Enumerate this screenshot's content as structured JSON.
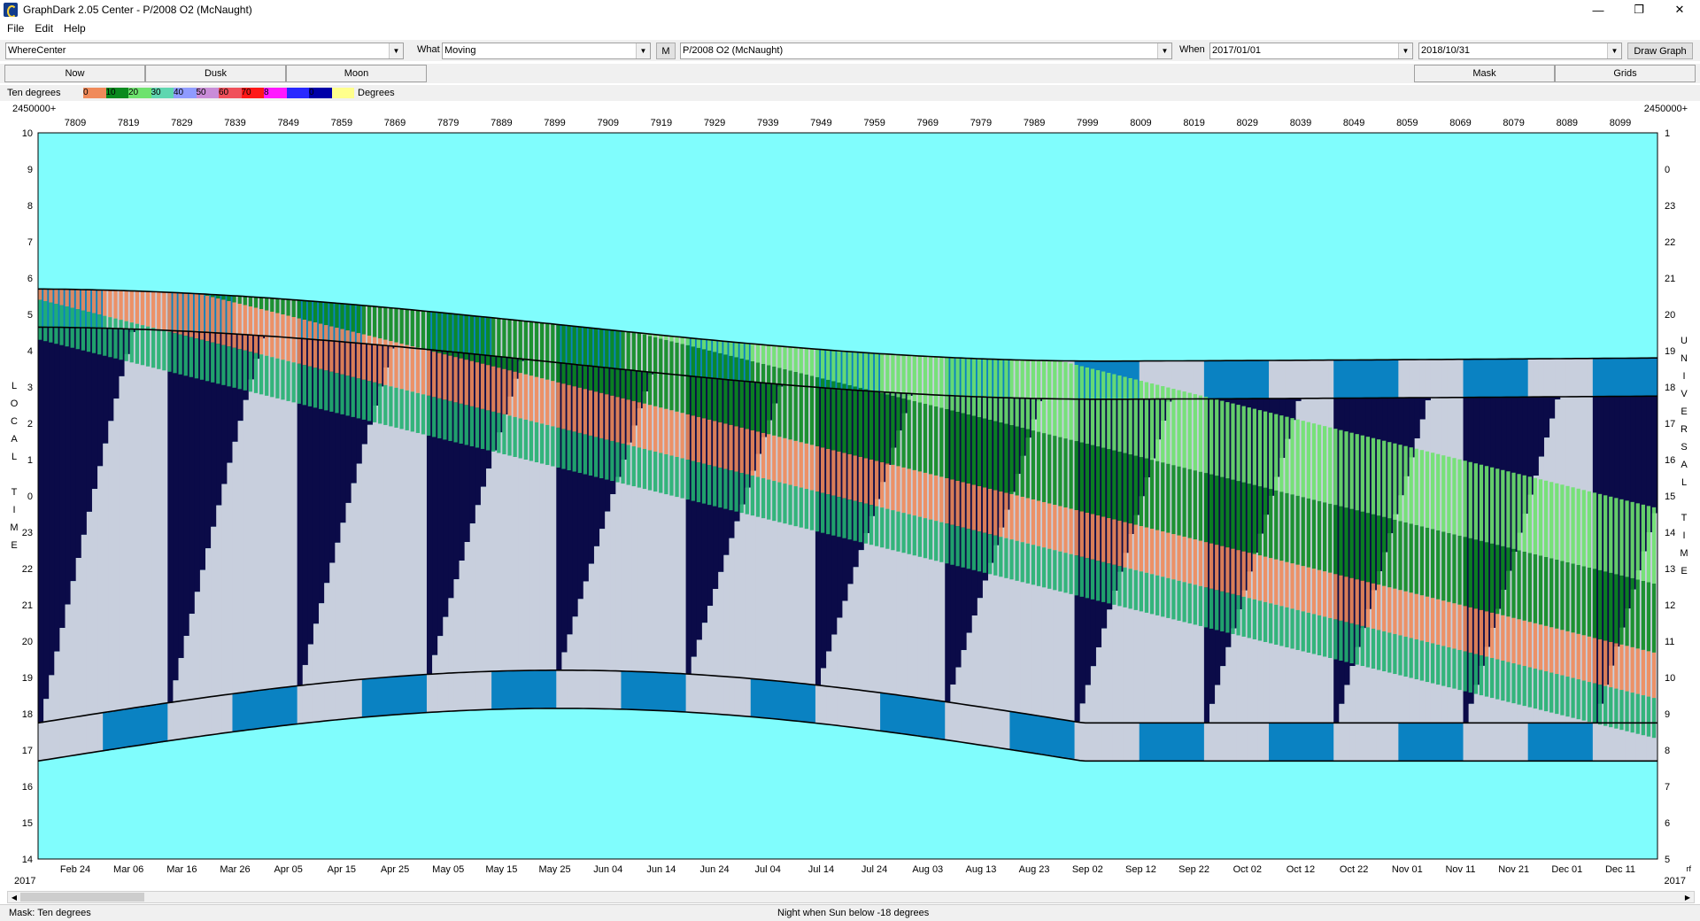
{
  "window": {
    "title": "GraphDark 2.05  Center  -  P/2008 O2 (McNaught)",
    "minimize": "—",
    "maximize": "❐",
    "close": "✕"
  },
  "menu": {
    "items": [
      "File",
      "Edit",
      "Help"
    ]
  },
  "toolbar": {
    "where_label": "Where",
    "where_value": "Center",
    "what_label": "What",
    "what_value": "Moving",
    "m_button": "M",
    "object_value": "P/2008 O2 (McNaught)",
    "when_label": "When",
    "start_date": "2017/01/01",
    "end_date": "2018/10/31",
    "draw_button": "Draw Graph"
  },
  "tabs": {
    "now": "Now",
    "dusk": "Dusk",
    "moon": "Moon",
    "mask": "Mask",
    "grids": "Grids"
  },
  "legend": {
    "left_label": "Ten degrees",
    "right_label": "Degrees",
    "stops": [
      {
        "label": "0",
        "color": "#f08a5a"
      },
      {
        "label": "10",
        "color": "#0a8a1e"
      },
      {
        "label": "20",
        "color": "#6ee26e"
      },
      {
        "label": "30",
        "color": "#5fd6b0"
      },
      {
        "label": "40",
        "color": "#8f9bff"
      },
      {
        "label": "50",
        "color": "#c98cd8"
      },
      {
        "label": "60",
        "color": "#f0505a"
      },
      {
        "label": "70",
        "color": "#ff1818"
      },
      {
        "label": "8",
        "color": "#ff18ff"
      },
      {
        "label": "",
        "color": "#2828ff"
      },
      {
        "label": "0",
        "color": "#0000a8"
      },
      {
        "label": "",
        "color": "#ffff8c"
      }
    ]
  },
  "chart_data": {
    "type": "heatmap",
    "jd_prefix": "2450000+",
    "top_ticks": [
      "7809",
      "7819",
      "7829",
      "7839",
      "7849",
      "7859",
      "7869",
      "7879",
      "7889",
      "7899",
      "7909",
      "7919",
      "7929",
      "7939",
      "7949",
      "7959",
      "7969",
      "7979",
      "7989",
      "7999",
      "8009",
      "8019",
      "8029",
      "8039",
      "8049",
      "8059",
      "8069",
      "8079",
      "8089",
      "8099"
    ],
    "bottom_ticks": [
      "Feb 24",
      "Mar 06",
      "Mar 16",
      "Mar 26",
      "Apr 05",
      "Apr 15",
      "Apr 25",
      "May 05",
      "May 15",
      "May 25",
      "Jun 04",
      "Jun 14",
      "Jun 24",
      "Jul 04",
      "Jul 14",
      "Jul 24",
      "Aug 03",
      "Aug 13",
      "Aug 23",
      "Sep 02",
      "Sep 12",
      "Sep 22",
      "Oct 02",
      "Oct 12",
      "Oct 22",
      "Nov 01",
      "Nov 11",
      "Nov 21",
      "Dec 01",
      "Dec 11"
    ],
    "year_left": "2017",
    "year_right": "2017",
    "left_axis_ticks": [
      "10",
      "9",
      "8",
      "7",
      "6",
      "5",
      "4",
      "3",
      "2",
      "1",
      "0",
      "23",
      "22",
      "21",
      "20",
      "19",
      "18",
      "17",
      "16",
      "15",
      "14"
    ],
    "right_axis_ticks": [
      "1",
      "0",
      "23",
      "22",
      "21",
      "20",
      "19",
      "18",
      "17",
      "16",
      "15",
      "14",
      "13",
      "12",
      "11",
      "10",
      "9",
      "8",
      "7",
      "6",
      "5"
    ],
    "left_axis_title": [
      "L",
      "O",
      "C",
      "A",
      "L",
      "",
      "T",
      "I",
      "M",
      "E"
    ],
    "right_axis_title": [
      "U",
      "N",
      "I",
      "V",
      "E",
      "R",
      "S",
      "A",
      "L",
      "",
      "T",
      "I",
      "M",
      "E"
    ],
    "right_edge_label": "rf",
    "colors": {
      "day": "#80fdfd",
      "night": "#0b0b48",
      "twilight": "#0a82c2",
      "moon": "#c8cfdd",
      "alt_0_10": "#f08a5a",
      "alt_10_20": "#0a8a1e",
      "alt_20_30": "#6ee26e",
      "alt_30_40": "#22b070"
    }
  },
  "status": {
    "mask_text": "Mask:  Ten degrees",
    "night_text": "Night when Sun below -18 degrees"
  }
}
